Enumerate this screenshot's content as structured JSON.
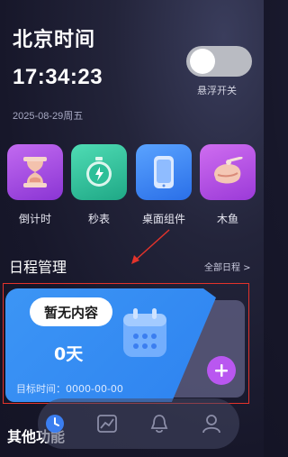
{
  "clock": {
    "title": "北京时间",
    "time": "17:34:23",
    "date": "2025-08-29周五"
  },
  "float_toggle": {
    "label": "悬浮开关",
    "state": "off"
  },
  "tools": [
    {
      "label": "倒计时",
      "icon": "hourglass-icon",
      "color": "#a34fe0"
    },
    {
      "label": "秒表",
      "icon": "stopwatch-icon",
      "color": "#2dbf9b"
    },
    {
      "label": "桌面组件",
      "icon": "phone-widget-icon",
      "color": "#2f7ff2"
    },
    {
      "label": "木鱼",
      "icon": "wooden-fish-icon",
      "color": "#b84ee0"
    }
  ],
  "schedule": {
    "section_title": "日程管理",
    "all_link": "全部日程 >",
    "badge": "暂无内容",
    "days": "0天",
    "target": "目标时间：0000-00-00"
  },
  "other": {
    "section_title": "其他功能"
  },
  "tabbar": {
    "items": [
      "clock-icon",
      "chart-icon",
      "bell-icon",
      "user-icon"
    ],
    "active": 0
  },
  "colors": {
    "accent_blue": "#2e83f0",
    "accent_purple": "#b957f0",
    "highlight_red": "#e3332b"
  }
}
